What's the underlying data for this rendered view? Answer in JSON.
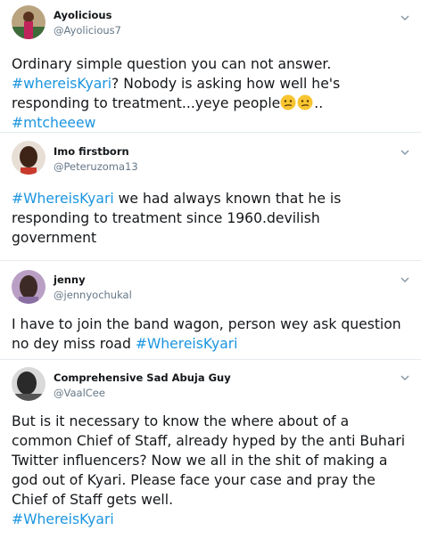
{
  "tweets": [
    {
      "name": "Ayolicious",
      "handle": "@Ayolicious7",
      "text": [
        "Ordinary simple question you can not answer.",
        "#whereisKyari",
        "? Nobody is asking how well he's",
        "responding to treatment...yeye people",
        "..",
        "#mtcheeew"
      ]
    },
    {
      "name": "Imo firstborn",
      "handle": "@Peteruzoma13",
      "text": [
        "#WhereisKyari",
        " we had always known that he is",
        "responding to treatment since 1960.devilish",
        "government"
      ]
    },
    {
      "name": "jenny",
      "handle": "@jennyochukal",
      "text": [
        "I have to join the band wagon, person wey ask question",
        "no dey miss road ",
        "#WhereisKyari"
      ]
    },
    {
      "name": "Comprehensive Sad Abuja Guy",
      "handle": "@VaalCee",
      "text": [
        "But is it necessary to know the where about of a",
        "common Chief of Staff, already hyped by the anti Buhari",
        "Twitter influencers? Now we all in the shit of making a",
        "god out of Kyari. Please face your case and pray the",
        "Chief of Staff gets well.",
        "#WhereisKyari"
      ]
    }
  ],
  "icons": {
    "avatar": "avatar",
    "caret": "chevron-down-icon",
    "emoji": "confused-face-emoji"
  },
  "colors": {
    "hashtag": "#1b95e0",
    "text": "#14171a",
    "secondary": "#657786",
    "separator": "#e6ecf0"
  }
}
